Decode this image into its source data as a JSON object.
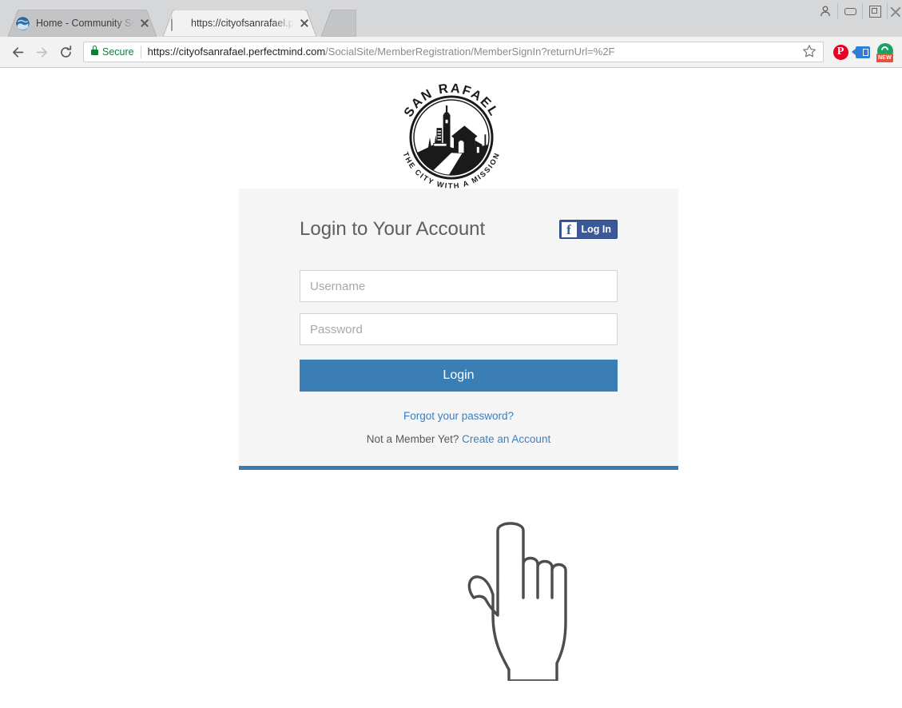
{
  "browser": {
    "tabs": [
      {
        "title": "Home - Community Serv",
        "favicon": "globe-favicon",
        "active": false
      },
      {
        "title": "https://cityofsanrafael.pe",
        "favicon": "document-favicon",
        "active": true
      }
    ],
    "toolbar": {
      "back_icon": "back-arrow-icon",
      "forward_icon": "forward-arrow-icon",
      "reload_icon": "reload-icon",
      "secure_label": "Secure",
      "lock_icon": "lock-icon",
      "url_host": "https://cityofsanrafael.perfectmind.com",
      "url_path": "/SocialSite/MemberRegistration/MemberSignIn?returnUrl=%2F",
      "bookmark_icon": "star-icon"
    },
    "extensions": [
      {
        "name": "pinterest-extension-icon",
        "glyph": "P",
        "color": "#e60023"
      },
      {
        "name": "bluetag-extension-icon",
        "color": "#2f7fd8"
      },
      {
        "name": "green-extension-icon",
        "color": "#1aa260",
        "badge": "NEW"
      }
    ],
    "window_controls": [
      {
        "name": "profile-button",
        "icon": "person-icon"
      },
      {
        "name": "minimize-button",
        "icon": "minimize-icon"
      },
      {
        "name": "maximize-button",
        "icon": "maximize-icon"
      },
      {
        "name": "close-button",
        "icon": "close-icon"
      }
    ]
  },
  "page": {
    "logo": {
      "top_text": "SAN RAFAEL",
      "bottom_text": "THE CITY WITH A MISSION",
      "alt": "san-rafael-city-seal"
    },
    "card": {
      "title": "Login to Your Account",
      "facebook": {
        "glyph": "f",
        "label": "Log In"
      },
      "username_placeholder": "Username",
      "username_value": "",
      "password_placeholder": "Password",
      "password_value": "",
      "login_button": "Login",
      "forgot_link": "Forgot your password?",
      "signup_prefix": "Not a Member Yet? ",
      "signup_link": "Create an Account",
      "accent_color": "#3a7eb5",
      "background_color": "#f5f5f5"
    },
    "cursor": "pointing-hand-cursor"
  }
}
